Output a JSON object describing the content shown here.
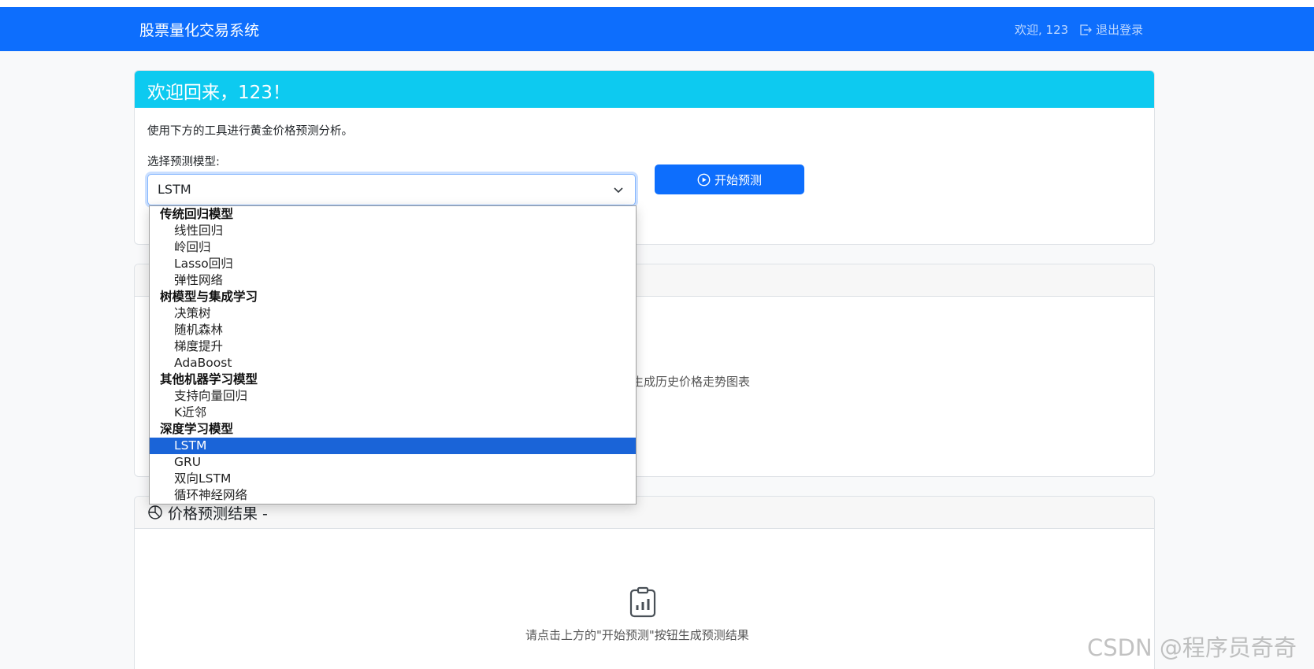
{
  "navbar": {
    "brand": "股票量化交易系统",
    "welcome": "欢迎, 123",
    "logout_label": "退出登录"
  },
  "welcome_card": {
    "title": "欢迎回来，123！",
    "lead": "使用下方的工具进行黄金价格预测分析。",
    "model_label": "选择预测模型:",
    "selected_model": "LSTM",
    "predict_button": "开始预测"
  },
  "dropdown": {
    "groups": [
      {
        "label": "传统回归模型",
        "options": [
          "线性回归",
          "岭回归",
          "Lasso回归",
          "弹性网络"
        ]
      },
      {
        "label": "树模型与集成学习",
        "options": [
          "决策树",
          "随机森林",
          "梯度提升",
          "AdaBoost"
        ]
      },
      {
        "label": "其他机器学习模型",
        "options": [
          "支持向量回归",
          "K近邻"
        ]
      },
      {
        "label": "深度学习模型",
        "options": [
          "LSTM",
          "GRU",
          "双向LSTM",
          "循环神经网络"
        ]
      }
    ]
  },
  "history_card": {
    "empty_text": "按钮生成历史价格走势图表"
  },
  "prediction_card": {
    "title": "价格预测结果 -",
    "empty_text": "请点击上方的\"开始预测\"按钮生成预测结果"
  },
  "watermark": "CSDN @程序员奇奇"
}
